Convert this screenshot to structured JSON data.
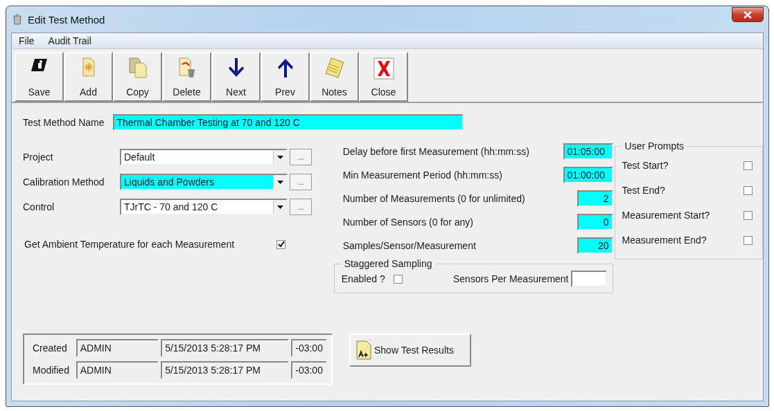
{
  "window": {
    "title": "Edit Test Method"
  },
  "menu": [
    "File",
    "Audit Trail"
  ],
  "toolbar": [
    {
      "kind": "save",
      "label": "Save"
    },
    {
      "kind": "add",
      "label": "Add"
    },
    {
      "kind": "copy",
      "label": "Copy"
    },
    {
      "kind": "delete",
      "label": "Delete"
    },
    {
      "kind": "next",
      "label": "Next"
    },
    {
      "kind": "prev",
      "label": "Prev"
    },
    {
      "kind": "notes",
      "label": "Notes"
    },
    {
      "kind": "close",
      "label": "Close"
    }
  ],
  "name_field": {
    "label": "Test Method Name",
    "value": "Thermal Chamber Testing at 70 and 120 C",
    "highlighted": true
  },
  "combos": [
    {
      "label": "Project",
      "value": "Default",
      "highlighted": false,
      "button": "..."
    },
    {
      "label": "Calibration Method",
      "value": "Liquids and Powders",
      "highlighted": true,
      "button": "..."
    },
    {
      "label": "Control",
      "value": "TJrTC - 70 and 120 C",
      "highlighted": false,
      "button": "..."
    }
  ],
  "ambient": {
    "label": "Get Ambient Temperature for each Measurement",
    "checked": true
  },
  "timing": [
    {
      "label": "Delay before first Measurement (hh:mm:ss)",
      "value": "01:05:00",
      "highlighted": true,
      "kind": "time"
    },
    {
      "label": "Min Measurement Period (hh:mm:ss)",
      "value": "01:00:00",
      "highlighted": true,
      "kind": "time"
    },
    {
      "label": "Number of Measurements (0 for unlimited)",
      "value": "2",
      "highlighted": true,
      "kind": "number"
    },
    {
      "label": "Number of Sensors (0 for any)",
      "value": "0",
      "highlighted": true,
      "kind": "number"
    },
    {
      "label": "Samples/Sensor/Measurement",
      "value": "20",
      "highlighted": true,
      "kind": "number"
    }
  ],
  "staggered": {
    "title": "Staggered Sampling",
    "enabled_label": "Enabled ?",
    "enabled": false,
    "sensors_label": "Sensors Per Measurement",
    "highlighted": false
  },
  "user_prompts": {
    "title": "User Prompts",
    "items": [
      {
        "label": "Test Start?",
        "checked": false
      },
      {
        "label": "Test End?",
        "checked": false
      },
      {
        "label": "Measurement Start?",
        "checked": false
      },
      {
        "label": "Measurement End?",
        "checked": false
      }
    ]
  },
  "audit": [
    {
      "label": "Created",
      "user": "ADMIN",
      "date": "5/15/2013 5:28:17 PM",
      "offset": "-03:00"
    },
    {
      "label": "Modified",
      "user": "ADMIN",
      "date": "5/15/2013 5:28:17 PM",
      "offset": "-03:00"
    }
  ],
  "results_button": {
    "label": "Show Test Results"
  }
}
